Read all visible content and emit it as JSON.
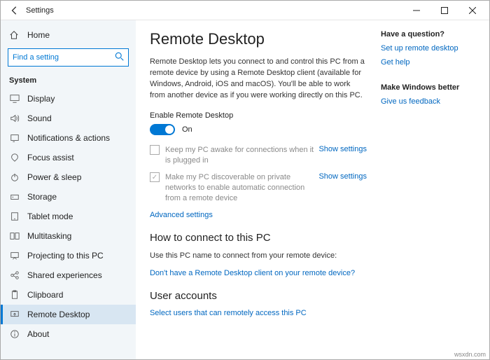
{
  "titlebar": {
    "title": "Settings"
  },
  "sidebar": {
    "home": "Home",
    "search_placeholder": "Find a setting",
    "group": "System",
    "items": [
      {
        "label": "Display"
      },
      {
        "label": "Sound"
      },
      {
        "label": "Notifications & actions"
      },
      {
        "label": "Focus assist"
      },
      {
        "label": "Power & sleep"
      },
      {
        "label": "Storage"
      },
      {
        "label": "Tablet mode"
      },
      {
        "label": "Multitasking"
      },
      {
        "label": "Projecting to this PC"
      },
      {
        "label": "Shared experiences"
      },
      {
        "label": "Clipboard"
      },
      {
        "label": "Remote Desktop"
      },
      {
        "label": "About"
      }
    ]
  },
  "main": {
    "title": "Remote Desktop",
    "description": "Remote Desktop lets you connect to and control this PC from a remote device by using a Remote Desktop client (available for Windows, Android, iOS and macOS). You'll be able to work from another device as if you were working directly on this PC.",
    "enable_label": "Enable Remote Desktop",
    "toggle_state": "On",
    "opt1_text": "Keep my PC awake for connections when it is plugged in",
    "opt1_action": "Show settings",
    "opt2_text": "Make my PC discoverable on private networks to enable automatic connection from a remote device",
    "opt2_action": "Show settings",
    "advanced": "Advanced settings",
    "howto_title": "How to connect to this PC",
    "howto_text": "Use this PC name to connect from your remote device:",
    "no_client": "Don't have a Remote Desktop client on your remote device?",
    "accounts_title": "User accounts",
    "accounts_link": "Select users that can remotely access this PC"
  },
  "aside": {
    "q_title": "Have a question?",
    "q_link1": "Set up remote desktop",
    "q_link2": "Get help",
    "fb_title": "Make Windows better",
    "fb_link": "Give us feedback"
  },
  "watermark": "wsxdn.com"
}
